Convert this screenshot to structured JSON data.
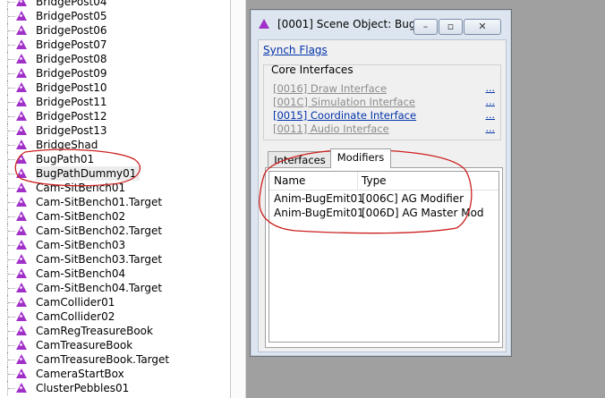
{
  "tree": {
    "items": [
      {
        "label": "BridgePost04"
      },
      {
        "label": "BridgePost05"
      },
      {
        "label": "BridgePost06"
      },
      {
        "label": "BridgePost07"
      },
      {
        "label": "BridgePost08"
      },
      {
        "label": "BridgePost09"
      },
      {
        "label": "BridgePost10"
      },
      {
        "label": "BridgePost11"
      },
      {
        "label": "BridgePost12"
      },
      {
        "label": "BridgePost13"
      },
      {
        "label": "BridgeShad"
      },
      {
        "label": "BugPath01"
      },
      {
        "label": "BugPathDummy01"
      },
      {
        "label": "Cam-SitBench01"
      },
      {
        "label": "Cam-SitBench01.Target"
      },
      {
        "label": "Cam-SitBench02"
      },
      {
        "label": "Cam-SitBench02.Target"
      },
      {
        "label": "Cam-SitBench03"
      },
      {
        "label": "Cam-SitBench03.Target"
      },
      {
        "label": "Cam-SitBench04"
      },
      {
        "label": "Cam-SitBench04.Target"
      },
      {
        "label": "CamCollider01"
      },
      {
        "label": "CamCollider02"
      },
      {
        "label": "CamRegTreasureBook"
      },
      {
        "label": "CamTreasureBook"
      },
      {
        "label": "CamTreasureBook.Target"
      },
      {
        "label": "CameraStartBox"
      },
      {
        "label": "ClusterPebbles01"
      }
    ],
    "selected_label": "BugPathDummy01"
  },
  "dialog": {
    "title": "[0001] Scene Object: BugPa...",
    "buttons": {
      "minimize": "–",
      "maximize": "▫",
      "close": "✕"
    },
    "synch_flags": "Synch Flags",
    "core_interfaces": {
      "title": "Core Interfaces",
      "items": [
        {
          "label": "[0016] Draw Interface",
          "more": "...",
          "state": "dim"
        },
        {
          "label": "[001C] Simulation Interface",
          "more": "...",
          "state": "dim"
        },
        {
          "label": "[0015] Coordinate Interface",
          "more": "...",
          "state": "active"
        },
        {
          "label": "[0011] Audio Interface",
          "more": "...",
          "state": "dim"
        }
      ]
    },
    "tabs": [
      {
        "label": "Interfaces",
        "active": false
      },
      {
        "label": "Modifiers",
        "active": true
      }
    ],
    "modifiers_list": {
      "columns": [
        "Name",
        "Type"
      ],
      "rows": [
        {
          "name": "Anim-BugEmit01",
          "type": "[006C] AG Modifier"
        },
        {
          "name": "Anim-BugEmit01",
          "type": "[006D] AG Master Mod"
        }
      ]
    }
  },
  "annotation_color": "#cc2020",
  "icon_color": "#a030c8"
}
